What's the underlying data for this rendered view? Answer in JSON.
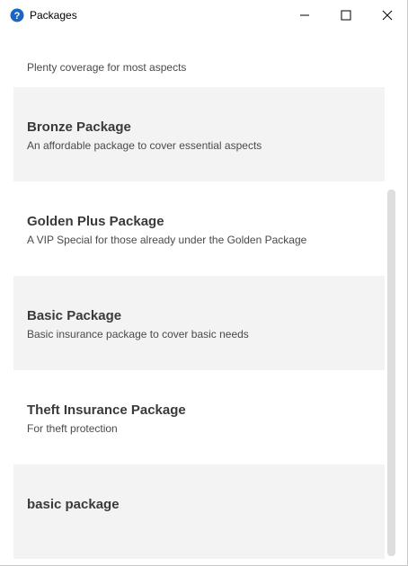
{
  "window": {
    "title": "Packages",
    "controls": {
      "minimize": "minimize-icon",
      "maximize": "maximize-icon",
      "close": "close-icon"
    }
  },
  "packages": [
    {
      "title": "",
      "description": "Plenty coverage for most aspects"
    },
    {
      "title": "Bronze Package",
      "description": "An affordable package to cover essential aspects"
    },
    {
      "title": "Golden Plus Package",
      "description": "A VIP Special for those already under the Golden Package"
    },
    {
      "title": "Basic Package",
      "description": "Basic insurance package to cover basic needs"
    },
    {
      "title": "Theft Insurance Package",
      "description": "For theft protection"
    },
    {
      "title": "basic package",
      "description": ""
    }
  ],
  "colors": {
    "alt_row": "#f3f3f3",
    "title_text": "#3a3a3a",
    "help_icon": "#1a66c2"
  }
}
